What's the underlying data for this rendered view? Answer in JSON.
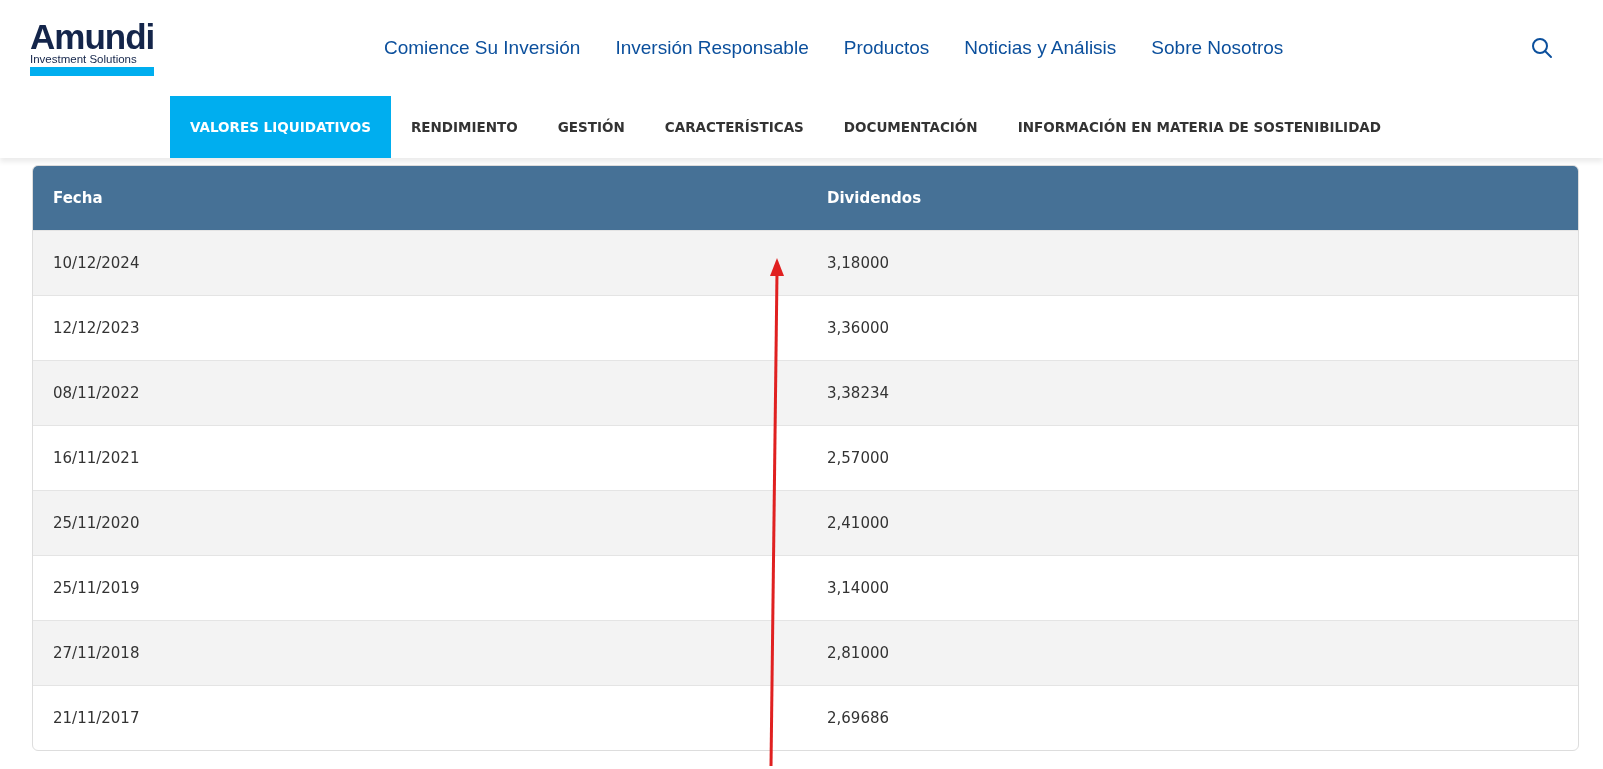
{
  "logo": {
    "name": "Amundi",
    "tagline": "Investment Solutions"
  },
  "nav": [
    "Comience Su Inversión",
    "Inversión Responsable",
    "Productos",
    "Noticias y Análisis",
    "Sobre Nosotros"
  ],
  "tabs": [
    {
      "label": "VALORES LIQUIDATIVOS",
      "selected": true
    },
    {
      "label": "RENDIMIENTO",
      "selected": false
    },
    {
      "label": "GESTIÓN",
      "selected": false
    },
    {
      "label": "CARACTERÍSTICAS",
      "selected": false
    },
    {
      "label": "DOCUMENTACIÓN",
      "selected": false
    },
    {
      "label": "INFORMACIÓN EN MATERIA DE SOSTENIBILIDAD",
      "selected": false
    }
  ],
  "table": {
    "columns": [
      "Fecha",
      "Dividendos"
    ],
    "rows": [
      [
        "10/12/2024",
        "3,18000"
      ],
      [
        "12/12/2023",
        "3,36000"
      ],
      [
        "08/11/2022",
        "3,38234"
      ],
      [
        "16/11/2021",
        "2,57000"
      ],
      [
        "25/11/2020",
        "2,41000"
      ],
      [
        "25/11/2019",
        "3,14000"
      ],
      [
        "27/11/2018",
        "2,81000"
      ],
      [
        "21/11/2017",
        "2,69686"
      ]
    ]
  }
}
